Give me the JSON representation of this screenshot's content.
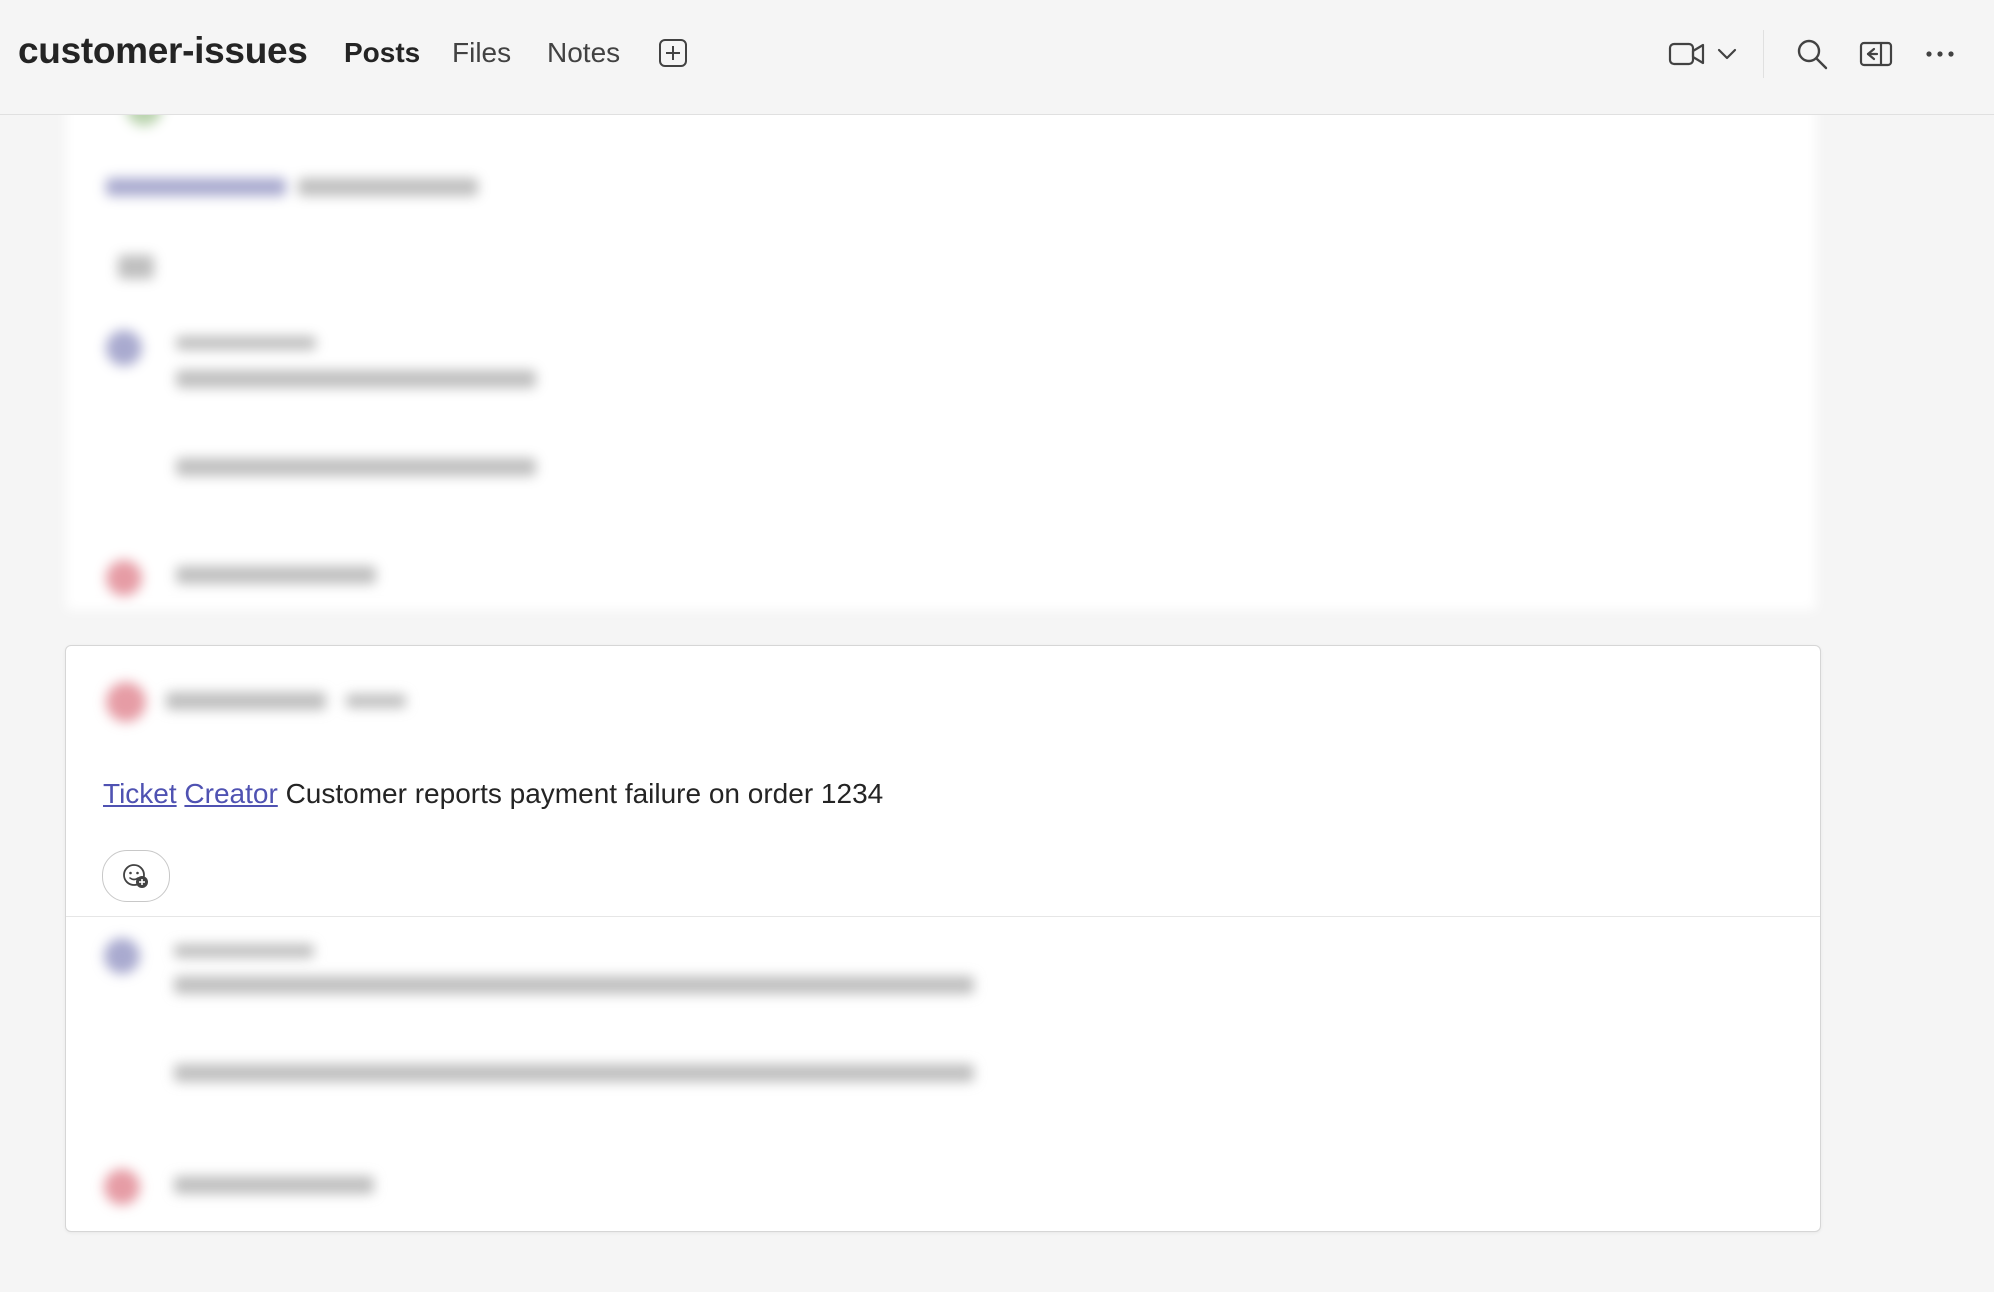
{
  "header": {
    "channel_name": "customer-issues",
    "tabs": [
      {
        "label": "Posts",
        "active": true
      },
      {
        "label": "Files",
        "active": false
      },
      {
        "label": "Notes",
        "active": false
      }
    ],
    "icons": [
      "add-tab-icon",
      "video-icon",
      "chevron-down-icon",
      "search-icon",
      "panel-icon",
      "more-icon"
    ]
  },
  "post": {
    "mentions": [
      "Ticket",
      "Creator"
    ],
    "message": "Customer reports payment failure on order 1234",
    "reaction_icon": "add-reaction-icon"
  },
  "colors": {
    "accent": "#6264a7",
    "mention": "#4f52b2",
    "background": "#f5f5f5"
  }
}
